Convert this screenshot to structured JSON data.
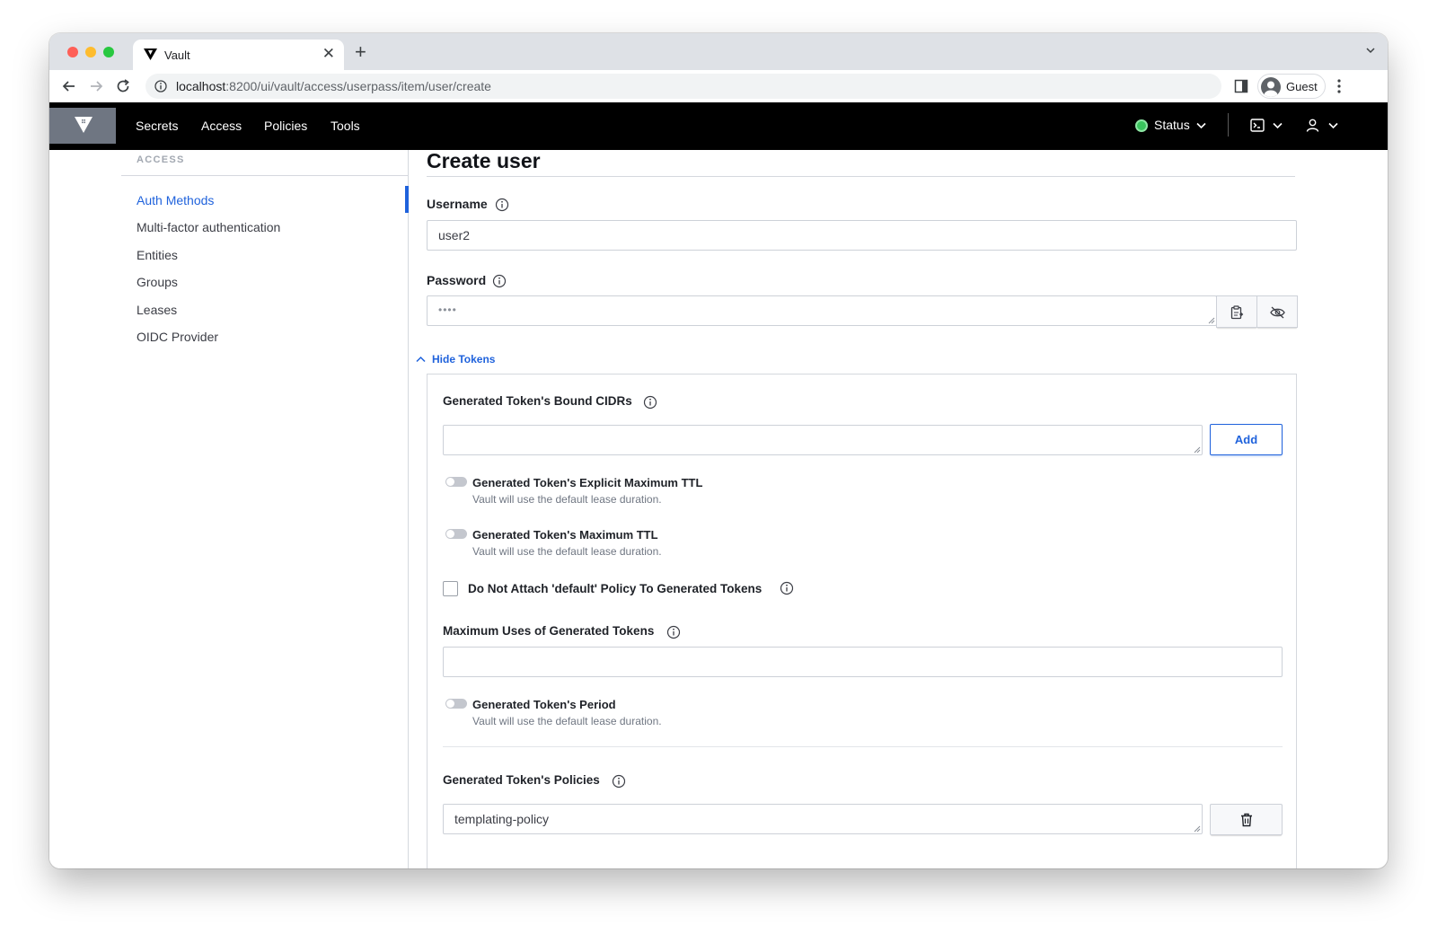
{
  "browser": {
    "tab_title": "Vault",
    "url_host": "localhost",
    "url_rest": ":8200/ui/vault/access/userpass/item/user/create",
    "profile_label": "Guest"
  },
  "header": {
    "nav": [
      "Secrets",
      "Access",
      "Policies",
      "Tools"
    ],
    "status_label": "Status",
    "status_color": "#3ac35d"
  },
  "sidebar": {
    "heading": "ACCESS",
    "items": [
      {
        "label": "Auth Methods",
        "active": true
      },
      {
        "label": "Multi-factor authentication",
        "active": false
      },
      {
        "label": "Entities",
        "active": false
      },
      {
        "label": "Groups",
        "active": false
      },
      {
        "label": "Leases",
        "active": false
      },
      {
        "label": "OIDC Provider",
        "active": false
      }
    ]
  },
  "form": {
    "title": "Create user",
    "username_label": "Username",
    "username_value": "user2",
    "password_label": "Password",
    "password_value": "••••",
    "toggle_label": "Hide Tokens",
    "bound_cidrs_label": "Generated Token's Bound CIDRs",
    "bound_cidrs_value": "",
    "add_label": "Add",
    "explicit_max_ttl_label": "Generated Token's Explicit Maximum TTL",
    "explicit_max_ttl_help": "Vault will use the default lease duration.",
    "max_ttl_label": "Generated Token's Maximum TTL",
    "max_ttl_help": "Vault will use the default lease duration.",
    "no_default_policy_label": "Do Not Attach 'default' Policy To Generated Tokens",
    "max_uses_label": "Maximum Uses of Generated Tokens",
    "max_uses_value": "",
    "period_label": "Generated Token's Period",
    "period_help": "Vault will use the default lease duration.",
    "policies_label": "Generated Token's Policies",
    "policies_value": "templating-policy"
  },
  "colors": {
    "accent": "#1f62dc",
    "header_bg": "#000000"
  }
}
